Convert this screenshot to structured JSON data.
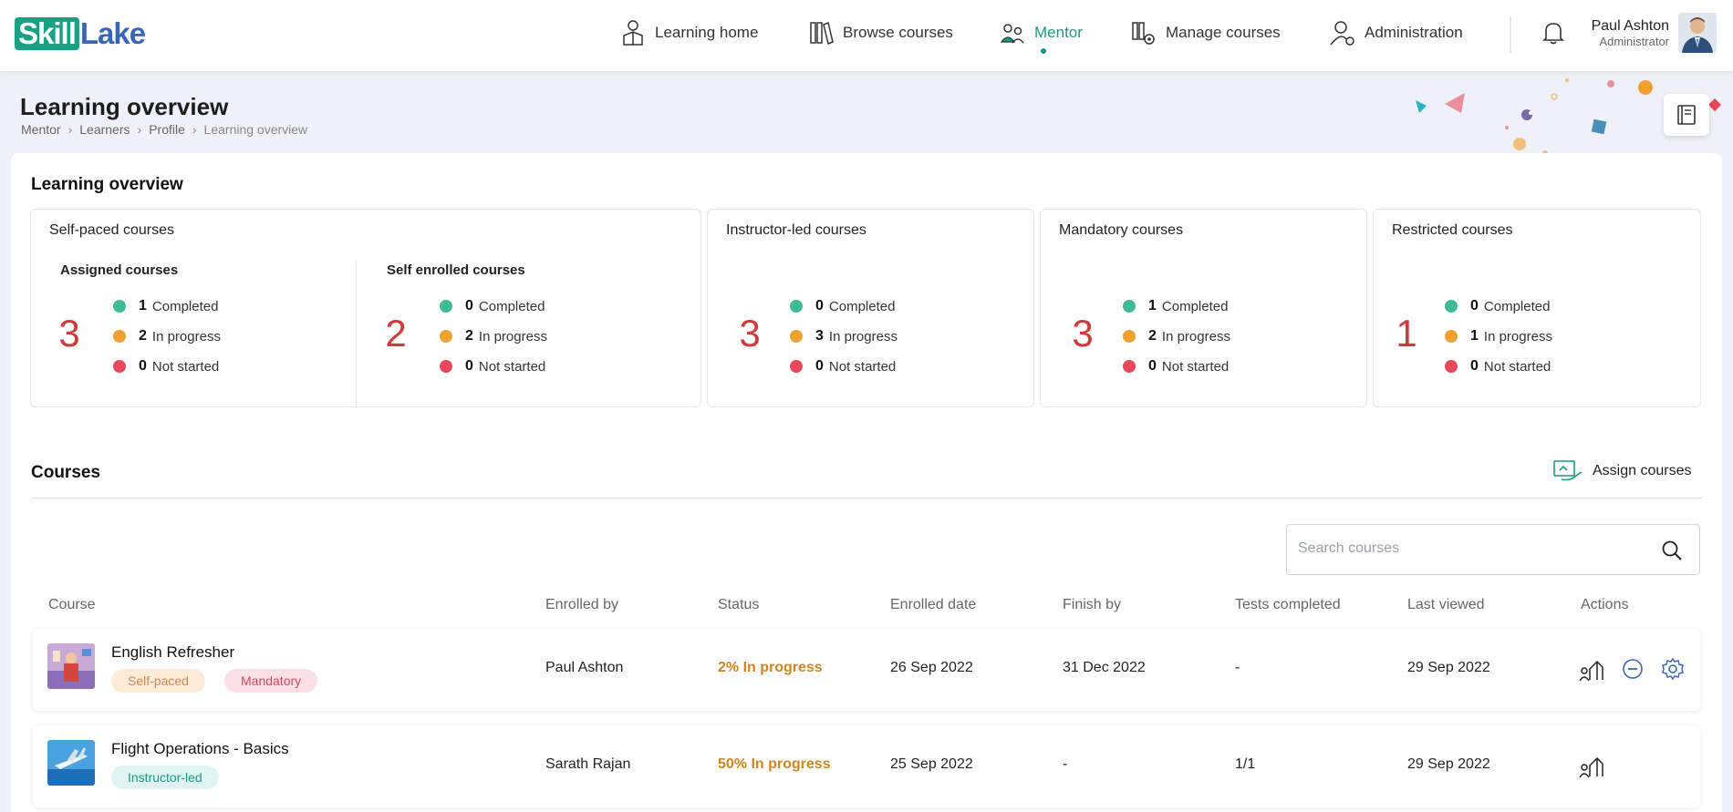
{
  "brand": {
    "part1": "Skill",
    "part2": "Lake"
  },
  "nav": {
    "learning_home": "Learning home",
    "browse_courses": "Browse courses",
    "mentor": "Mentor",
    "manage_courses": "Manage courses",
    "administration": "Administration"
  },
  "user": {
    "name": "Paul Ashton",
    "role": "Administrator"
  },
  "header": {
    "title": "Learning overview",
    "breadcrumb": [
      "Mentor",
      "Learners",
      "Profile",
      "Learning overview"
    ]
  },
  "overview": {
    "title": "Learning overview",
    "self_paced": {
      "title": "Self-paced courses",
      "assigned": {
        "title": "Assigned courses",
        "total": "3",
        "completed": "1",
        "in_progress": "2",
        "not_started": "0"
      },
      "self_enrolled": {
        "title": "Self enrolled courses",
        "total": "2",
        "completed": "0",
        "in_progress": "2",
        "not_started": "0"
      }
    },
    "instructor_led": {
      "title": "Instructor-led courses",
      "total": "3",
      "completed": "0",
      "in_progress": "3",
      "not_started": "0"
    },
    "mandatory": {
      "title": "Mandatory courses",
      "total": "3",
      "completed": "1",
      "in_progress": "2",
      "not_started": "0"
    },
    "restricted": {
      "title": "Restricted courses",
      "total": "1",
      "completed": "0",
      "in_progress": "1",
      "not_started": "0"
    },
    "labels": {
      "completed": "Completed",
      "in_progress": "In progress",
      "not_started": "Not started"
    }
  },
  "courses": {
    "title": "Courses",
    "assign_label": "Assign courses",
    "search_placeholder": "Search courses",
    "columns": [
      "Course",
      "Enrolled by",
      "Status",
      "Enrolled date",
      "Finish by",
      "Tests completed",
      "Last viewed",
      "Actions"
    ],
    "rows": [
      {
        "name": "English Refresher",
        "tags": [
          "Self-paced",
          "Mandatory"
        ],
        "enrolled_by": "Paul Ashton",
        "status": "2% In progress",
        "enrolled_date": "26 Sep 2022",
        "finish_by": "31 Dec 2022",
        "tests": "-",
        "last_viewed": "29 Sep 2022"
      },
      {
        "name": "Flight Operations - Basics",
        "tags": [
          "Instructor-led"
        ],
        "enrolled_by": "Sarath Rajan",
        "status": "50% In progress",
        "enrolled_date": "25 Sep 2022",
        "finish_by": "-",
        "tests": "1/1",
        "last_viewed": "29 Sep 2022"
      }
    ]
  },
  "colors": {
    "accent": "#1a9a83",
    "completed": "#3dba96",
    "in_progress": "#f0a030",
    "not_started": "#e8485a",
    "big_number": "#cf3a3a",
    "status": "#d2841e"
  }
}
